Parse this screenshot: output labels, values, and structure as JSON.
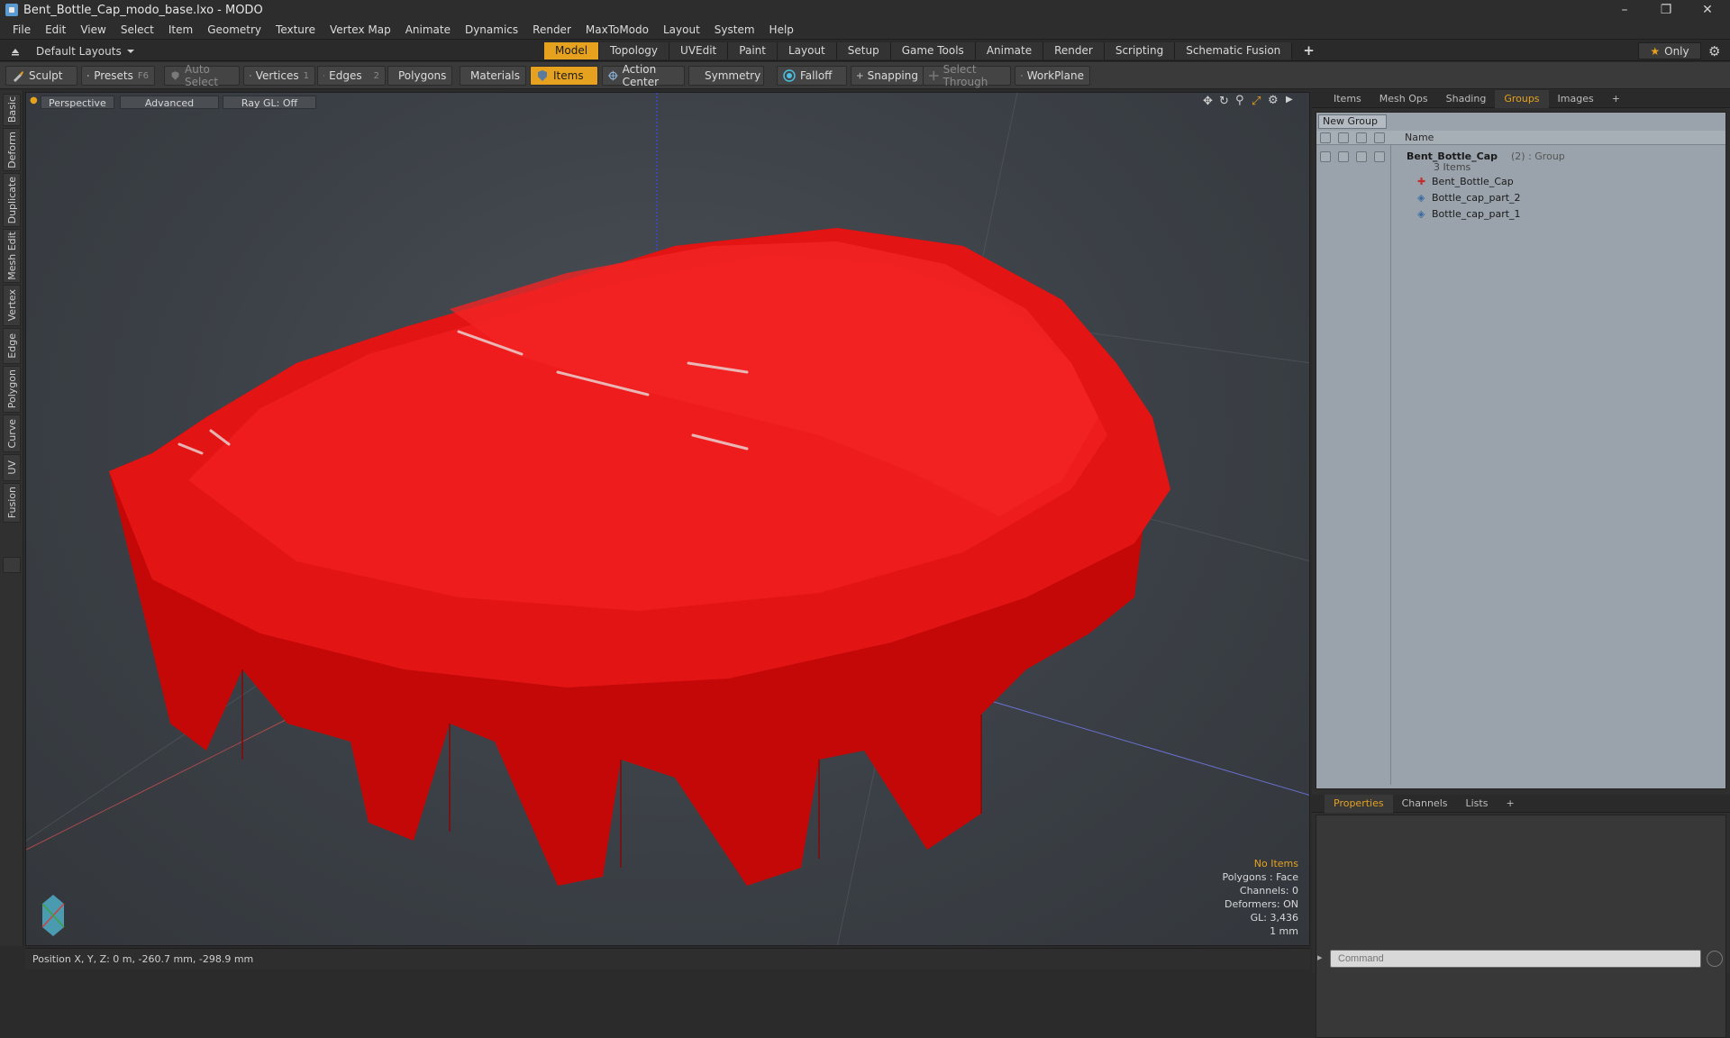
{
  "window": {
    "title": "Bent_Bottle_Cap_modo_base.lxo - MODO",
    "minimize": "–",
    "restore": "❐",
    "close": "✕"
  },
  "menu": [
    "File",
    "Edit",
    "View",
    "Select",
    "Item",
    "Geometry",
    "Texture",
    "Vertex Map",
    "Animate",
    "Dynamics",
    "Render",
    "MaxToModo",
    "Layout",
    "System",
    "Help"
  ],
  "layouts": {
    "label": "Default Layouts"
  },
  "tabs": [
    "Model",
    "Topology",
    "UVEdit",
    "Paint",
    "Layout",
    "Setup",
    "Game Tools",
    "Animate",
    "Render",
    "Scripting",
    "Schematic Fusion"
  ],
  "tabs_add": "+",
  "only_label": "Only",
  "toolbar": {
    "sculpt": "Sculpt",
    "presets": "Presets",
    "presets_key": "F6",
    "auto_select": "Auto Select",
    "vertices": "Vertices",
    "vertices_count": "1",
    "edges": "Edges",
    "edges_count": "2",
    "polygons": "Polygons",
    "materials": "Materials",
    "items": "Items",
    "action_center": "Action Center",
    "symmetry": "Symmetry",
    "falloff": "Falloff",
    "snapping": "Snapping",
    "select_through": "Select Through",
    "workplane": "WorkPlane"
  },
  "left_tabs": [
    "Basic",
    "Deform",
    "Duplicate",
    "Mesh Edit",
    "Vertex",
    "Edge",
    "Polygon",
    "Curve",
    "UV",
    "Fusion"
  ],
  "viewport": {
    "perspective": "Perspective",
    "advanced": "Advanced",
    "raygl": "Ray GL: Off",
    "info": {
      "no_items": "No Items",
      "polygons": "Polygons : Face",
      "channels": "Channels: 0",
      "deformers": "Deformers: ON",
      "gl": "GL: 3,436",
      "unit": "1 mm"
    }
  },
  "status": {
    "position": "Position X, Y, Z:  0 m, -260.7 mm, -298.9 mm"
  },
  "groups_panel": {
    "tabs": [
      "Items",
      "Mesh Ops",
      "Shading",
      "Groups",
      "Images"
    ],
    "active_tab": "Groups",
    "add": "+",
    "new_group": "New Group",
    "col_name": "Name",
    "group_name": "Bent_Bottle_Cap",
    "group_suffix": "(2) : Group",
    "group_count": "3 Items",
    "items": [
      "Bent_Bottle_Cap",
      "Bottle_cap_part_2",
      "Bottle_cap_part_1"
    ]
  },
  "props_panel": {
    "tabs": [
      "Properties",
      "Channels",
      "Lists"
    ],
    "add": "+"
  },
  "command": {
    "placeholder": "Command"
  },
  "colors": {
    "accent": "#e6a21f",
    "cap_red": "#e01010"
  }
}
